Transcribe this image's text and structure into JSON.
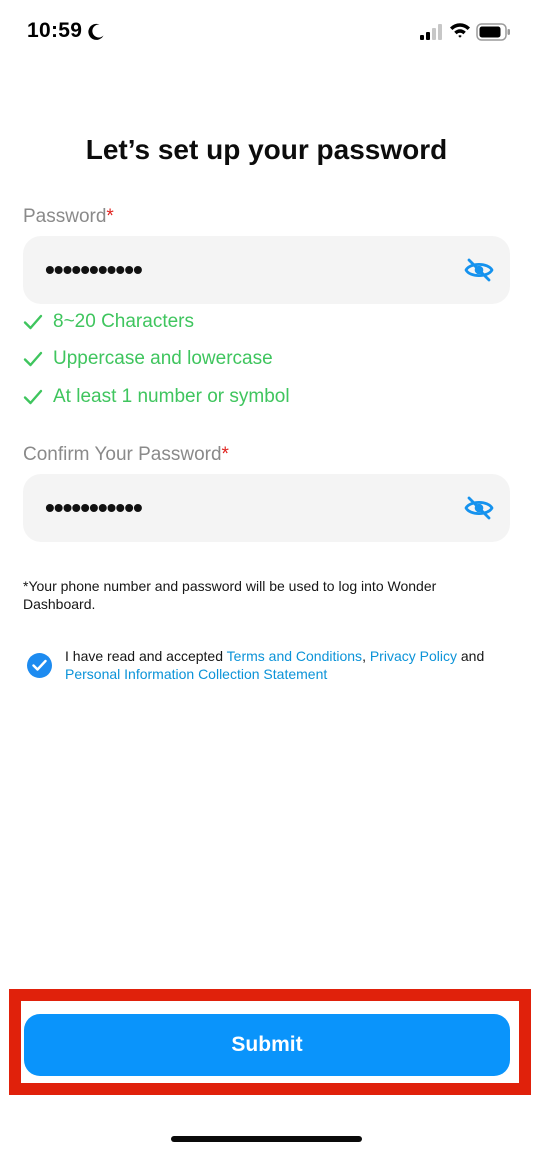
{
  "status_bar": {
    "time": "10:59",
    "icons": [
      "moon-icon",
      "signal-icon",
      "wifi-icon",
      "battery-icon"
    ]
  },
  "title": "Let’s set up your password",
  "password_field": {
    "label": "Password",
    "required_mark": "*",
    "value": "•••••••••••",
    "toggle_icon": "eye-slash-icon"
  },
  "rules": [
    {
      "text": "8~20 Characters",
      "icon": "check-icon"
    },
    {
      "text": "Uppercase and lowercase",
      "icon": "check-icon"
    },
    {
      "text": "At least 1 number or symbol",
      "icon": "check-icon"
    }
  ],
  "confirm_field": {
    "label": "Confirm Your Password",
    "required_mark": "*",
    "value": "•••••••••••",
    "toggle_icon": "eye-slash-icon"
  },
  "note": "*Your phone number and password will be used to log into Wonder Dashboard.",
  "agreement": {
    "checked": true,
    "prefix": "I have read and accepted ",
    "terms_link": "Terms and Conditions",
    "separator": ", ",
    "privacy_link": "Privacy Policy",
    "and_text": " and ",
    "pics_link": "Personal Information Collection Statement"
  },
  "submit_label": "Submit",
  "colors": {
    "accent": "#0a94fb",
    "success": "#3fc55e",
    "link": "#0b93d8",
    "required": "#e0231f",
    "highlight": "#e0210b"
  }
}
